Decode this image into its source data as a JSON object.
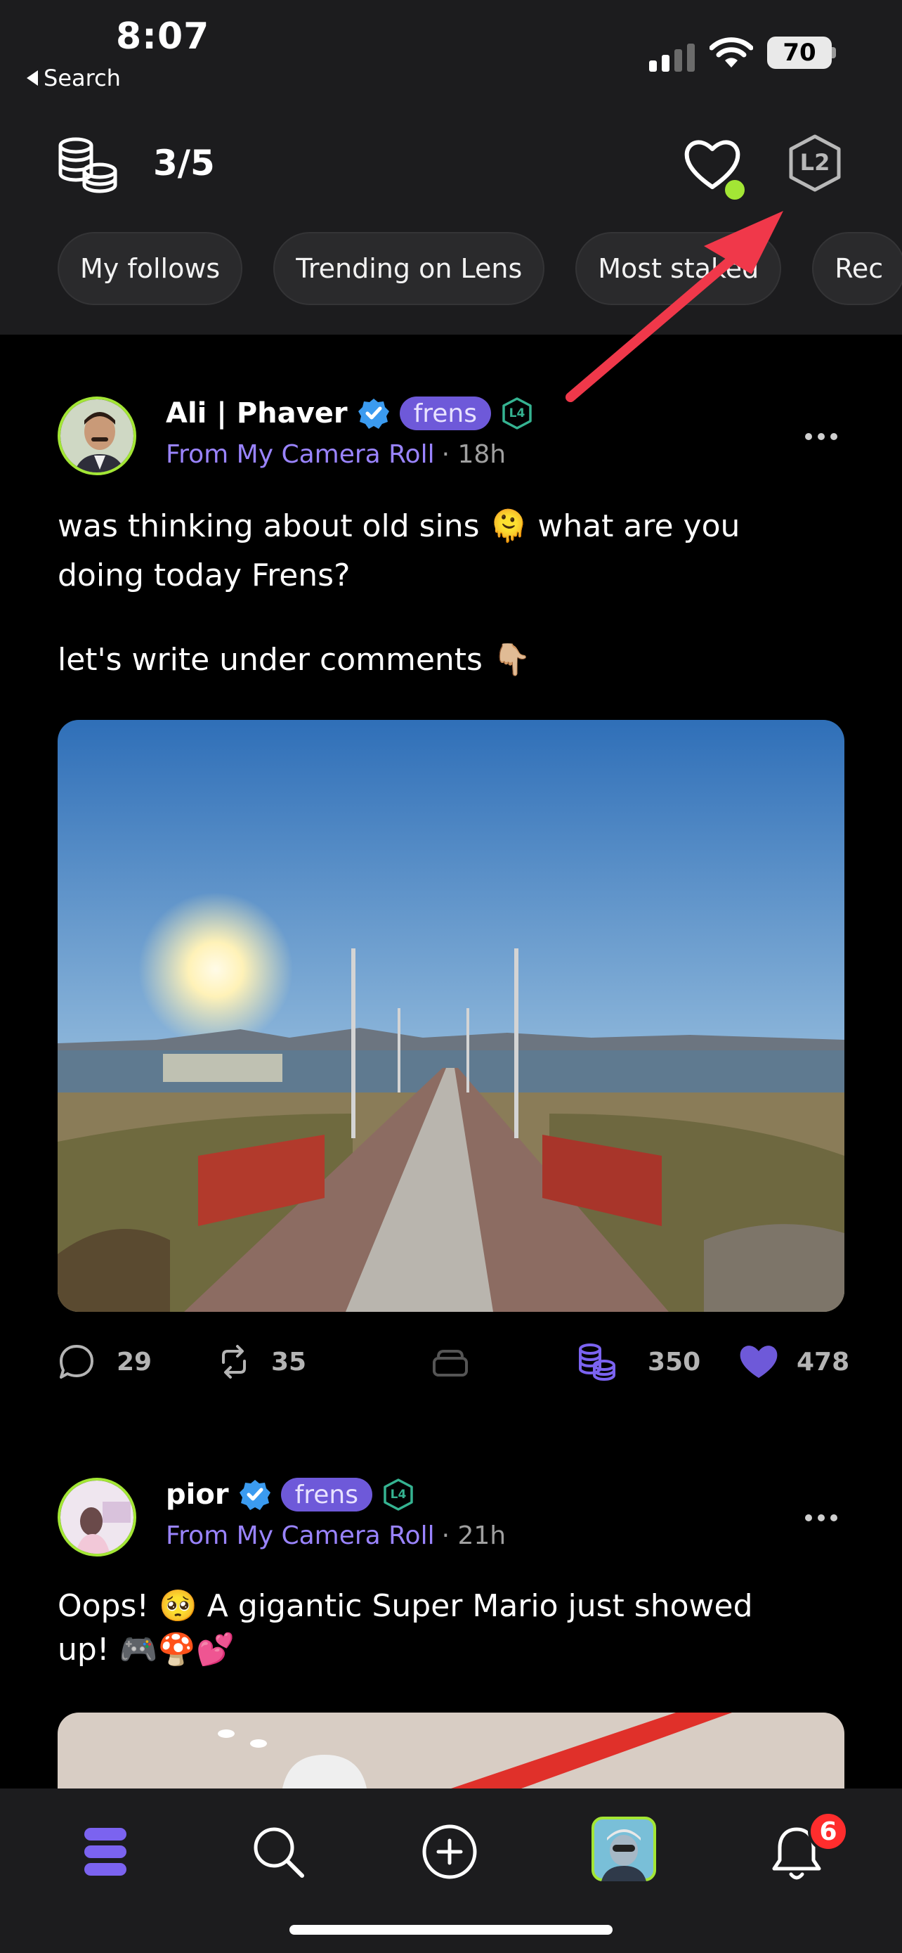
{
  "status_bar": {
    "time": "8:07",
    "back_label": "Search",
    "battery": "70"
  },
  "header": {
    "quota": "3/5",
    "level_badge": "L2",
    "tabs": [
      "My follows",
      "Trending on Lens",
      "Most staked",
      "Rec"
    ]
  },
  "posts": [
    {
      "author": "Ali | Phaver",
      "badge": "frens",
      "level": "L4",
      "source": "From My Camera Roll",
      "time": "· 18h",
      "text_lines": [
        "was thinking about old sins 🫠 what are you",
        "doing today Frens?"
      ],
      "text_line2": "let's write under comments 👇🏼",
      "comments": "29",
      "mirrors": "35",
      "stakes": "350",
      "likes": "478"
    },
    {
      "author": "pior",
      "badge": "frens",
      "level": "L4",
      "source": "From My Camera Roll",
      "time": "· 21h",
      "text_lines": [
        "Oops! 🥺 A gigantic Super Mario just showed",
        "up! 🎮🍄💕"
      ]
    }
  ],
  "bottom_nav": {
    "notification_count": "6"
  },
  "colors": {
    "accent": "#6e59d9",
    "lime": "#a3e635",
    "header_bg": "#1c1c1e",
    "annotation_arrow": "#f0384a"
  },
  "icons": [
    "coins-icon",
    "heart-icon",
    "level-hexagon-icon",
    "verified-icon",
    "comment-icon",
    "mirror-icon",
    "collect-icon",
    "stake-coins-icon",
    "like-heart-icon",
    "feed-icon",
    "search-icon",
    "add-icon",
    "bell-icon"
  ]
}
